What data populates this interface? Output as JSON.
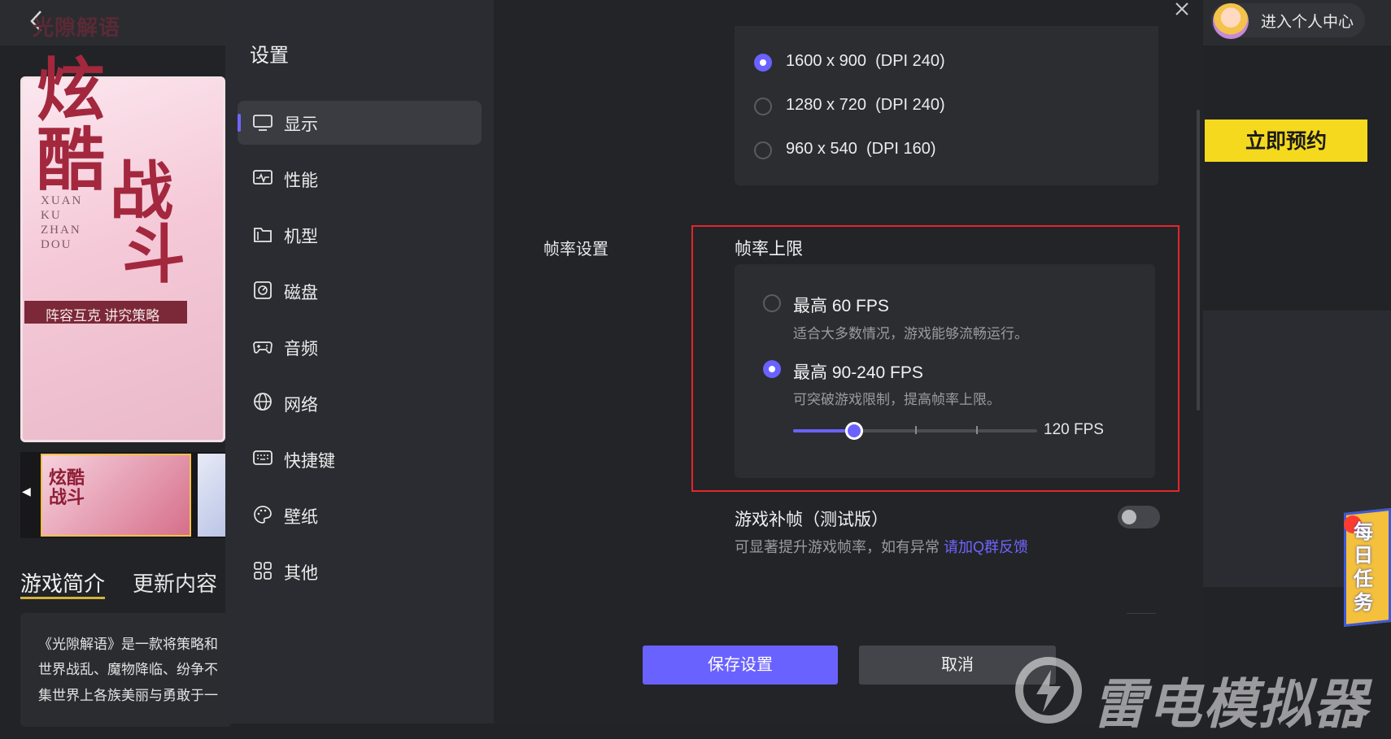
{
  "header": {
    "back_icon": "chevron-left-icon",
    "profile_label": "进入个人中心",
    "close_icon": "close-icon"
  },
  "game": {
    "poster": {
      "logo": "光隙解语",
      "title_chars": [
        "炫",
        "酷",
        "战",
        "斗"
      ],
      "pinyin": "XUAN\nKU\nZHAN\nDOU",
      "slogan": "阵容互克  讲究策略"
    },
    "thumbnail_label": "炫酷\n战斗",
    "reserve_button": "立即预约",
    "tabs": [
      {
        "label": "游戏简介",
        "active": true
      },
      {
        "label": "更新内容",
        "active": false
      }
    ],
    "intro_lines": [
      "《光隙解语》是一款将策略和",
      "世界战乱、魔物降临、纷争不",
      "集世界上各族美丽与勇敢于一"
    ]
  },
  "settings": {
    "title": "设置",
    "nav": [
      {
        "label": "显示",
        "icon": "monitor-icon",
        "active": true
      },
      {
        "label": "性能",
        "icon": "performance-icon",
        "active": false
      },
      {
        "label": "机型",
        "icon": "device-model-icon",
        "active": false
      },
      {
        "label": "磁盘",
        "icon": "disk-icon",
        "active": false
      },
      {
        "label": "音频",
        "icon": "gamepad-icon",
        "active": false
      },
      {
        "label": "网络",
        "icon": "globe-icon",
        "active": false
      },
      {
        "label": "快捷键",
        "icon": "keyboard-icon",
        "active": false
      },
      {
        "label": "壁纸",
        "icon": "palette-icon",
        "active": false
      },
      {
        "label": "其他",
        "icon": "grid-icon",
        "active": false
      }
    ],
    "resolutions": [
      {
        "label": "1600 x 900  (DPI 240)",
        "selected": true
      },
      {
        "label": "1280 x 720  (DPI 240)",
        "selected": false
      },
      {
        "label": "960 x 540  (DPI 160)",
        "selected": false
      }
    ],
    "framerate": {
      "section_label": "帧率设置",
      "cap_title": "帧率上限",
      "options": [
        {
          "title": "最高 60 FPS",
          "desc": "适合大多数情况，游戏能够流畅运行。",
          "selected": false
        },
        {
          "title": "最高 90-240 FPS",
          "desc": "可突破游戏限制，提高帧率上限。",
          "selected": true
        }
      ],
      "slider_value_label": "120 FPS",
      "slider_fraction": 0.25
    },
    "interpolation": {
      "title": "游戏补帧（测试版）",
      "desc": "可显著提升游戏帧率，如有异常",
      "link": "请加Q群反馈",
      "enabled": false
    },
    "save_button": "保存设置",
    "cancel_button": "取消"
  },
  "overlays": {
    "daily_task": "每日任务",
    "watermark": "雷电模拟器"
  },
  "colors": {
    "accent": "#6a62ff",
    "highlight_outline": "#e1262b",
    "reserve_button": "#f5d91e"
  }
}
